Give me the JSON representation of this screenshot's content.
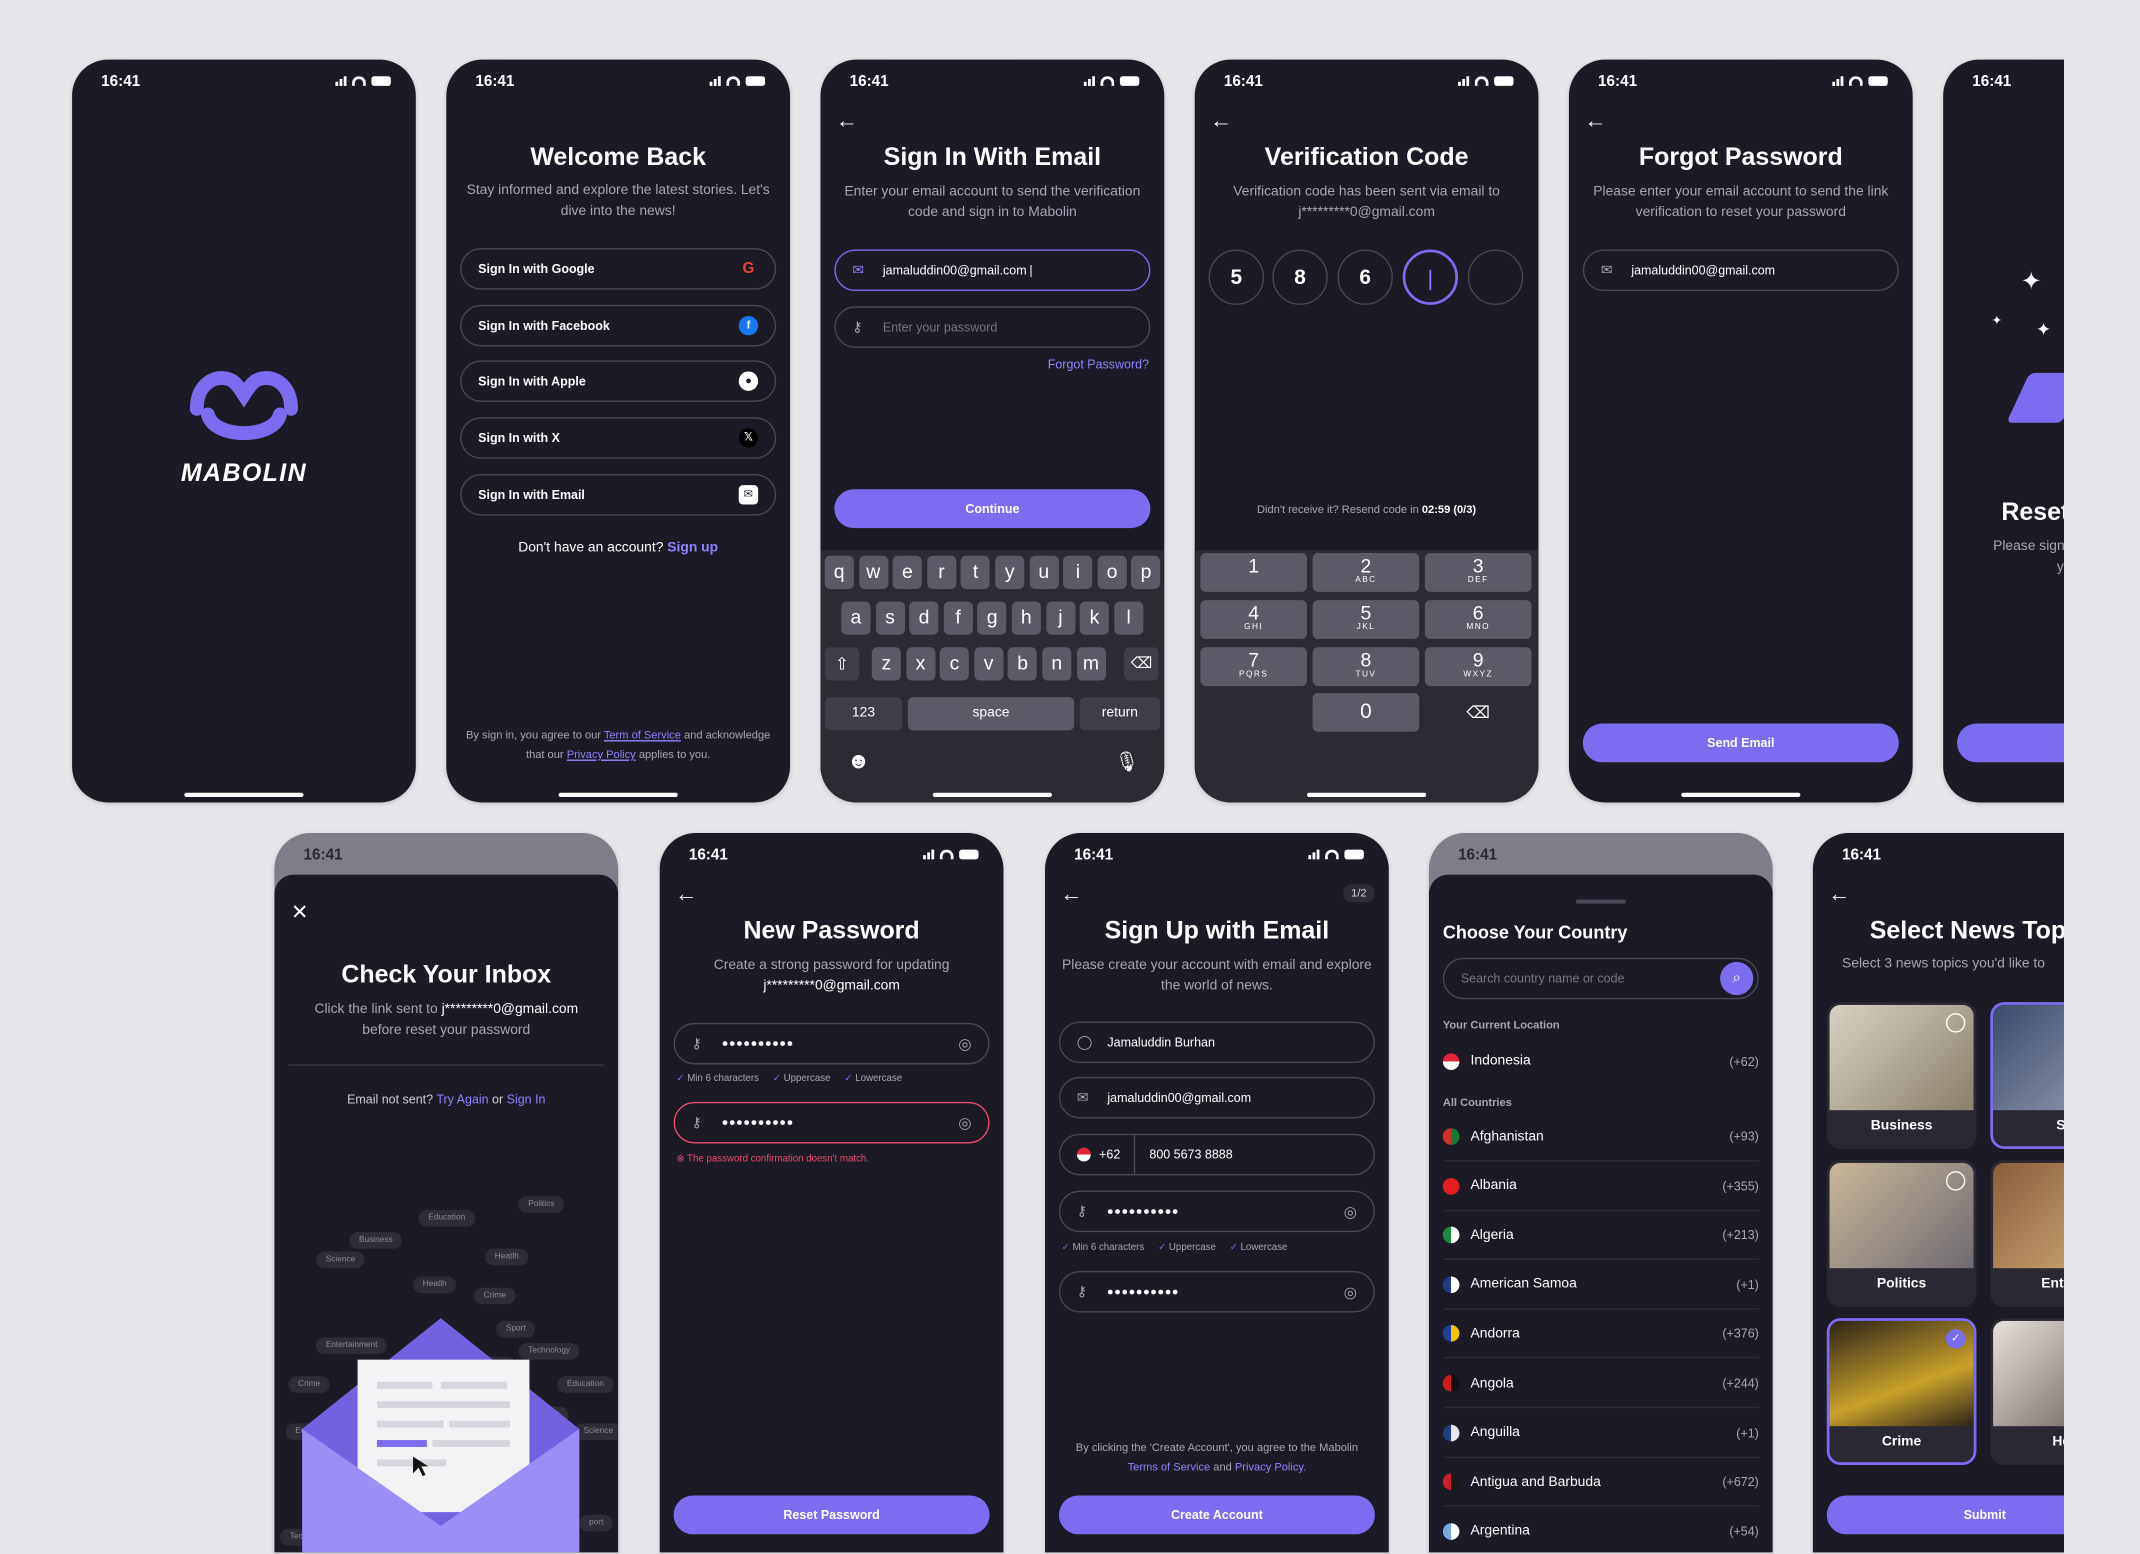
{
  "status_time": "16:41",
  "splash": {
    "brand": "MABOLIN"
  },
  "welcome": {
    "title": "Welcome Back",
    "subtitle": "Stay informed and explore the latest stories. Let's dive into the news!",
    "buttons": [
      "Sign In with Google",
      "Sign In with Facebook",
      "Sign In with Apple",
      "Sign In with X",
      "Sign In with Email"
    ],
    "no_account": "Don't have an account?",
    "sign_up": "Sign up",
    "terms_a": "By sign in, you agree to our",
    "terms_link": "Term of Service",
    "terms_b": "and acknowledge that our",
    "privacy_link": "Privacy Policy",
    "terms_c": "applies to you."
  },
  "email_signin": {
    "title": "Sign In With Email",
    "subtitle": "Enter your email account to send the verification code and sign in to Mabolin",
    "email": "jamaluddin00@gmail.com",
    "password_placeholder": "Enter your password",
    "forgot": "Forgot Password?",
    "continue": "Continue",
    "kb_row1": [
      "q",
      "w",
      "e",
      "r",
      "t",
      "y",
      "u",
      "i",
      "o",
      "p"
    ],
    "kb_row2": [
      "a",
      "s",
      "d",
      "f",
      "g",
      "h",
      "j",
      "k",
      "l"
    ],
    "kb_row3": [
      "z",
      "x",
      "c",
      "v",
      "b",
      "n",
      "m"
    ],
    "kb_123": "123",
    "kb_space": "space",
    "kb_return": "return"
  },
  "verification": {
    "title": "Verification Code",
    "subtitle": "Verification code has been sent via email to j*********0@gmail.com",
    "digits": [
      "5",
      "8",
      "6"
    ],
    "resend_a": "Didn't receive it? Resend code in",
    "resend_time": "02:59 (0/3)",
    "numpad": [
      {
        "n": "1",
        "l": ""
      },
      {
        "n": "2",
        "l": "ABC"
      },
      {
        "n": "3",
        "l": "DEF"
      },
      {
        "n": "4",
        "l": "GHI"
      },
      {
        "n": "5",
        "l": "JKL"
      },
      {
        "n": "6",
        "l": "MNO"
      },
      {
        "n": "7",
        "l": "PQRS"
      },
      {
        "n": "8",
        "l": "TUV"
      },
      {
        "n": "9",
        "l": "WXYZ"
      }
    ],
    "zero": "0"
  },
  "forgot": {
    "title": "Forgot Password",
    "subtitle": "Please enter your email account to send the link verification to reset your password",
    "email": "jamaluddin00@gmail.com",
    "send": "Send Email"
  },
  "reset_partial": {
    "title": "Reset",
    "line1": "Please sign",
    "line2": "yo"
  },
  "inbox": {
    "title": "Check Your Inbox",
    "subtitle_a": "Click the link sent to",
    "email": "j*********0@gmail.com",
    "subtitle_b": "before reset your password",
    "not_sent": "Email not sent?",
    "try_again": "Try Again",
    "or": "or",
    "sign_in": "Sign In",
    "tags": [
      "Politics",
      "Education",
      "Business",
      "Heatlh",
      "Science",
      "Crime",
      "Heatlh",
      "Sport",
      "Entertainment",
      "Technology",
      "Technology",
      "Business",
      "Crime",
      "Education",
      "Trav",
      "Education",
      "nterest",
      "Science",
      "Tech",
      "E",
      "port",
      "ent"
    ]
  },
  "new_password": {
    "title": "New Password",
    "subtitle_a": "Create a strong password for updating",
    "email": "j*********0@gmail.com",
    "dots": "••••••••••",
    "checks": [
      "Min 6 characters",
      "Uppercase",
      "Lowercase"
    ],
    "error": "The password confirmation doesn't match.",
    "reset": "Reset Password"
  },
  "signup": {
    "title": "Sign Up with Email",
    "step": "1/2",
    "subtitle": "Please create your account with email and explore the world of news.",
    "name": "Jamaluddin Burhan",
    "email": "jamaluddin00@gmail.com",
    "code": "+62",
    "phone": "800 5673 8888",
    "dots": "••••••••••",
    "checks": [
      "Min 6 characters",
      "Uppercase",
      "Lowercase"
    ],
    "terms_a": "By clicking the 'Create Account', you agree to the Mabolin",
    "terms_link": "Terms of Service",
    "and": "and",
    "privacy_link": "Privacy Policy.",
    "create": "Create Account"
  },
  "country": {
    "title": "Choose Your Country",
    "search_placeholder": "Search country name or code",
    "current_label": "Your Current Location",
    "current": {
      "name": "Indonesia",
      "code": "(+62)",
      "c1": "#e0243a",
      "c2": "#ffffff"
    },
    "all_label": "All Countries",
    "list": [
      {
        "name": "Afghanistan",
        "code": "(+93)",
        "c1": "#d32d2d",
        "c2": "#1a7a34"
      },
      {
        "name": "Albania",
        "code": "(+355)",
        "c1": "#e41e20",
        "c2": "#e41e20"
      },
      {
        "name": "Algeria",
        "code": "(+213)",
        "c1": "#1d8a3e",
        "c2": "#ffffff"
      },
      {
        "name": "American Samoa",
        "code": "(+1)",
        "c1": "#1f3c87",
        "c2": "#ffffff"
      },
      {
        "name": "Andorra",
        "code": "(+376)",
        "c1": "#1e3f9e",
        "c2": "#f3c400"
      },
      {
        "name": "Angola",
        "code": "(+244)",
        "c1": "#d21a1a",
        "c2": "#111111"
      },
      {
        "name": "Anguilla",
        "code": "(+1)",
        "c1": "#1f3c87",
        "c2": "#e8e8e8"
      },
      {
        "name": "Antigua and Barbuda",
        "code": "(+672)",
        "c1": "#cf1f2e",
        "c2": "#1a1a1a"
      },
      {
        "name": "Argentina",
        "code": "(+54)",
        "c1": "#74acdf",
        "c2": "#ffffff"
      }
    ]
  },
  "topics": {
    "title": "Select News Top",
    "subtitle": "Select 3 news topics you'd like to",
    "items": [
      {
        "label": "Business",
        "sel": false
      },
      {
        "label": "Sp",
        "sel": true
      },
      {
        "label": "Politics",
        "sel": false
      },
      {
        "label": "Enterta",
        "sel": false
      },
      {
        "label": "Crime",
        "sel": true
      },
      {
        "label": "Hea",
        "sel": false
      }
    ],
    "submit": "Submit"
  }
}
